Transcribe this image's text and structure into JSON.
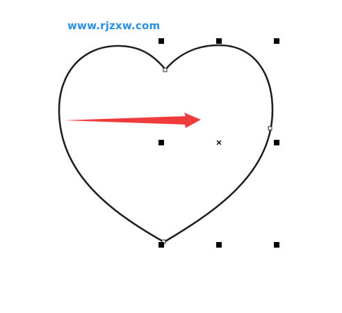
{
  "watermark": {
    "text": "www.rjzxw.com"
  },
  "colors": {
    "shape_outline": "#231f1e",
    "arrow": "#ef3b3b",
    "handle": "#000000",
    "watermark": "#2a8fe0"
  },
  "canvas": {
    "shape": "heart",
    "selection_handles": [
      "top-left",
      "top-center",
      "top-right",
      "middle-left",
      "middle-right",
      "bottom-left",
      "bottom-center",
      "bottom-right"
    ],
    "center_marker": "x-mark-icon",
    "annotation": "red-arrow-icon"
  }
}
